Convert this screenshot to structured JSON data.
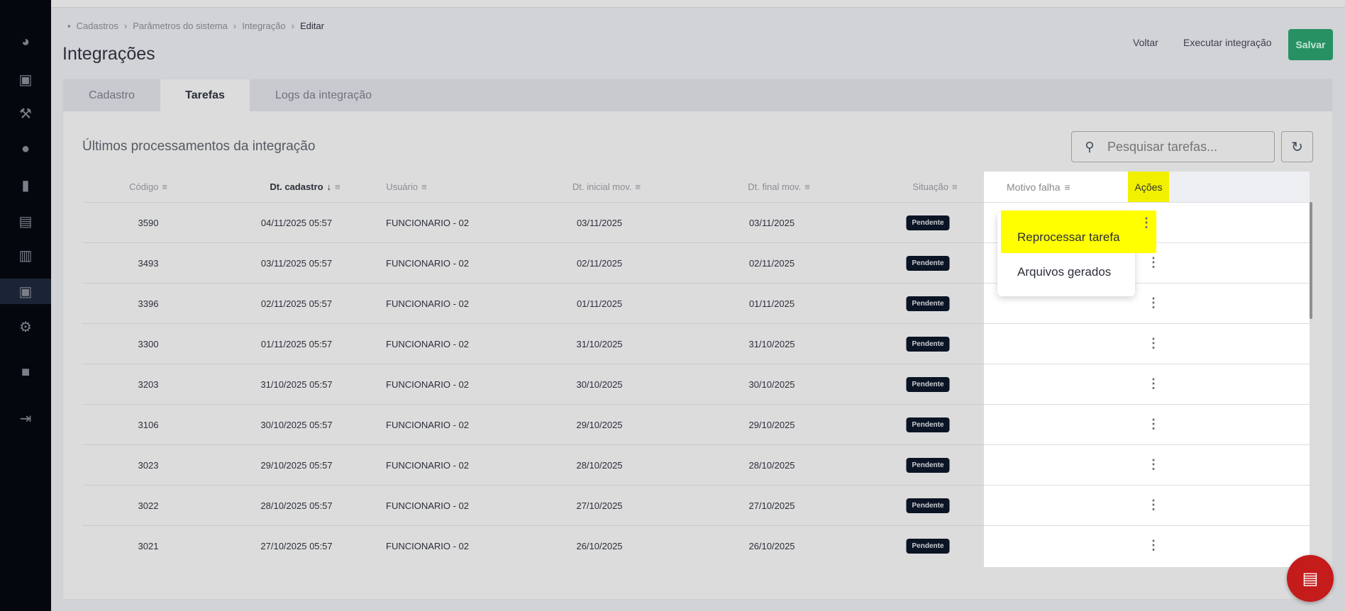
{
  "breadcrumb": [
    "Cadastros",
    "Parâmetros do sistema",
    "Integração",
    "Editar"
  ],
  "page_title": "Integrações",
  "header_actions": {
    "voltar": "Voltar",
    "executar": "Executar integração",
    "salvar": "Salvar"
  },
  "tabs": [
    "Cadastro",
    "Tarefas",
    "Logs da integração"
  ],
  "section_title": "Últimos processamentos da integração",
  "search": {
    "placeholder": "Pesquisar tarefas..."
  },
  "columns": {
    "codigo": "Código",
    "dt_cadastro": "Dt. cadastro",
    "usuario": "Usuário",
    "dt_inicial": "Dt. inicial mov.",
    "dt_final": "Dt. final mov.",
    "situacao": "Situação",
    "motivo": "Motivo falha",
    "acoes": "Ações"
  },
  "rows": [
    {
      "codigo": "3590",
      "dt_cadastro": "04/11/2025 05:57",
      "usuario": "FUNCIONARIO - 02",
      "dt_inicial": "03/11/2025",
      "dt_final": "03/11/2025",
      "situacao": "Pendente"
    },
    {
      "codigo": "3493",
      "dt_cadastro": "03/11/2025 05:57",
      "usuario": "FUNCIONARIO - 02",
      "dt_inicial": "02/11/2025",
      "dt_final": "02/11/2025",
      "situacao": "Pendente"
    },
    {
      "codigo": "3396",
      "dt_cadastro": "02/11/2025 05:57",
      "usuario": "FUNCIONARIO - 02",
      "dt_inicial": "01/11/2025",
      "dt_final": "01/11/2025",
      "situacao": "Pendente"
    },
    {
      "codigo": "3300",
      "dt_cadastro": "01/11/2025 05:57",
      "usuario": "FUNCIONARIO - 02",
      "dt_inicial": "31/10/2025",
      "dt_final": "31/10/2025",
      "situacao": "Pendente"
    },
    {
      "codigo": "3203",
      "dt_cadastro": "31/10/2025 05:57",
      "usuario": "FUNCIONARIO - 02",
      "dt_inicial": "30/10/2025",
      "dt_final": "30/10/2025",
      "situacao": "Pendente"
    },
    {
      "codigo": "3106",
      "dt_cadastro": "30/10/2025 05:57",
      "usuario": "FUNCIONARIO - 02",
      "dt_inicial": "29/10/2025",
      "dt_final": "29/10/2025",
      "situacao": "Pendente"
    },
    {
      "codigo": "3023",
      "dt_cadastro": "29/10/2025 05:57",
      "usuario": "FUNCIONARIO - 02",
      "dt_inicial": "28/10/2025",
      "dt_final": "28/10/2025",
      "situacao": "Pendente"
    },
    {
      "codigo": "3022",
      "dt_cadastro": "28/10/2025 05:57",
      "usuario": "FUNCIONARIO - 02",
      "dt_inicial": "27/10/2025",
      "dt_final": "27/10/2025",
      "situacao": "Pendente"
    },
    {
      "codigo": "3021",
      "dt_cadastro": "27/10/2025 05:57",
      "usuario": "FUNCIONARIO - 02",
      "dt_inicial": "26/10/2025",
      "dt_final": "26/10/2025",
      "situacao": "Pendente"
    }
  ],
  "action_menu": [
    "Reprocessar tarefa",
    "Arquivos gerados"
  ],
  "colors": {
    "accent": "#279163",
    "highlight": "#ffff00",
    "sidebar": "#05070f",
    "chat": "#c41b1b"
  }
}
